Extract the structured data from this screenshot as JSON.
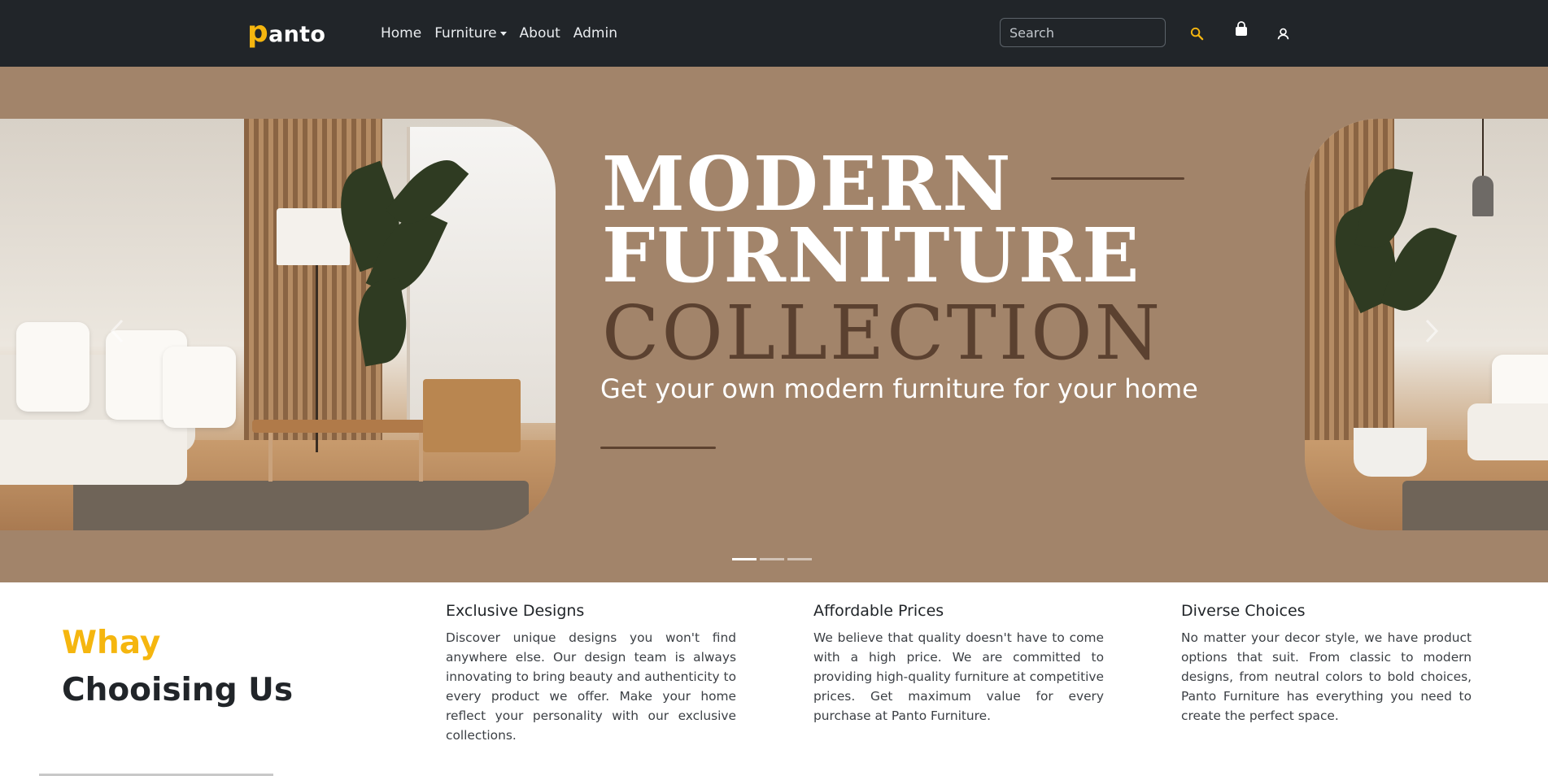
{
  "brand": {
    "first_letter": "p",
    "rest": "anto"
  },
  "nav": {
    "items": [
      {
        "label": "Home"
      },
      {
        "label": "Furniture",
        "has_dropdown": true
      },
      {
        "label": "About"
      },
      {
        "label": "Admin"
      }
    ],
    "search_placeholder": "Search",
    "icons": [
      "search-icon",
      "shopping-bag-icon",
      "user-icon"
    ]
  },
  "hero": {
    "line1": "MODERN",
    "line2": "FURNITURE",
    "line3": "COLLECTION",
    "subtitle": "Get your own modern furniture for your home",
    "slide_count": 3,
    "active_slide": 1,
    "colors": {
      "background": "#a2846a",
      "accent_dark": "#5b4130"
    }
  },
  "why": {
    "title_line1": "Whay",
    "title_line2": "Chooising Us",
    "features": [
      {
        "title": "Exclusive Designs",
        "text": "Discover unique designs you won't find anywhere else. Our design team is always innovating to bring beauty and authenticity to every product we offer. Make your home reflect your personality with our exclusive collections."
      },
      {
        "title": "Affordable Prices",
        "text": "We believe that quality doesn't have to come with a high price. We are committed to providing high-quality furniture at competitive prices. Get maximum value for every purchase at Panto Furniture."
      },
      {
        "title": "Diverse Choices",
        "text": "No matter your decor style, we have product options that suit. From classic to modern designs, from neutral colors to bold choices, Panto Furniture has everything you need to create the perfect space."
      }
    ]
  },
  "colors": {
    "navbar": "#212529",
    "brand_accent": "#f5b60f",
    "text_dark": "#212529"
  }
}
